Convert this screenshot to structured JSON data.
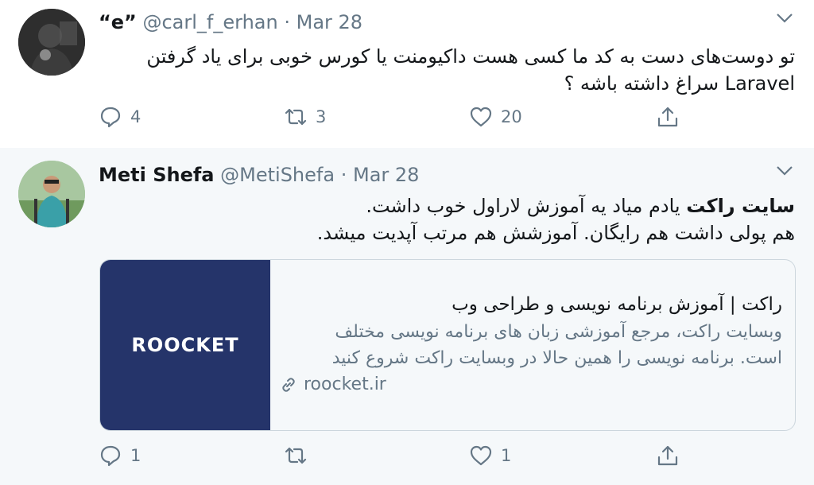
{
  "tweets": [
    {
      "author": {
        "name": "“e”",
        "handle": "@carl_f_erhan"
      },
      "date": "Mar 28",
      "separator": "·",
      "lines": [
        "تو دوست‌های دست به کد ما کسی هست داکیومنت یا کورس خوبی برای یاد گرفتن",
        "Laravel سراغ داشته باشه ؟"
      ],
      "actions": {
        "replies": "4",
        "retweets": "3",
        "likes": "20"
      }
    },
    {
      "author": {
        "name": "Meti Shefa",
        "handle": "@MetiShefa"
      },
      "date": "Mar 28",
      "separator": "·",
      "line1_bold": "سایت راکت",
      "line1_rest": " یادم میاد یه آموزش لاراول خوب داشت.",
      "line2": "هم پولی داشت هم رایگان. آموزشش هم مرتب آپدیت میشد.",
      "card": {
        "logo": "ROOCKET",
        "title": "راکت | آموزش برنامه نویسی و طراحی وب",
        "description_line1": "وبسایت راکت، مرجع آموزشی زبان های برنامه نویسی مختلف",
        "description_line2": "است. برنامه نویسی را همین حالا در وبسایت راکت شروع کنید",
        "domain": "roocket.ir"
      },
      "actions": {
        "replies": "1",
        "retweets": "",
        "likes": "1"
      }
    }
  ],
  "colors": {
    "text": "#14171a",
    "secondary": "#657786",
    "border": "#ccd6dd",
    "card_image_bg": "#25346a",
    "reply_bg": "#f5f8fa"
  },
  "icons": [
    "chevron-down-icon",
    "reply-icon",
    "retweet-icon",
    "like-icon",
    "share-icon",
    "link-icon"
  ]
}
